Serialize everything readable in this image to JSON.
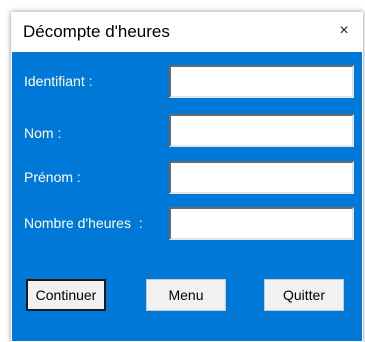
{
  "window": {
    "title": "Décompte d'heures",
    "close_glyph": "×"
  },
  "form": {
    "fields": [
      {
        "label": "Identifiant :",
        "value": ""
      },
      {
        "label": "Nom :",
        "value": ""
      },
      {
        "label": "Prénom :",
        "value": ""
      },
      {
        "label": "Nombre d'heures  :",
        "value": ""
      }
    ]
  },
  "buttons": {
    "continue_label": "Continuer",
    "menu_label": "Menu",
    "quit_label": "Quitter"
  },
  "colors": {
    "form_background": "#0078d7",
    "label_text": "#ffffff",
    "button_face": "#f1f1f1"
  }
}
